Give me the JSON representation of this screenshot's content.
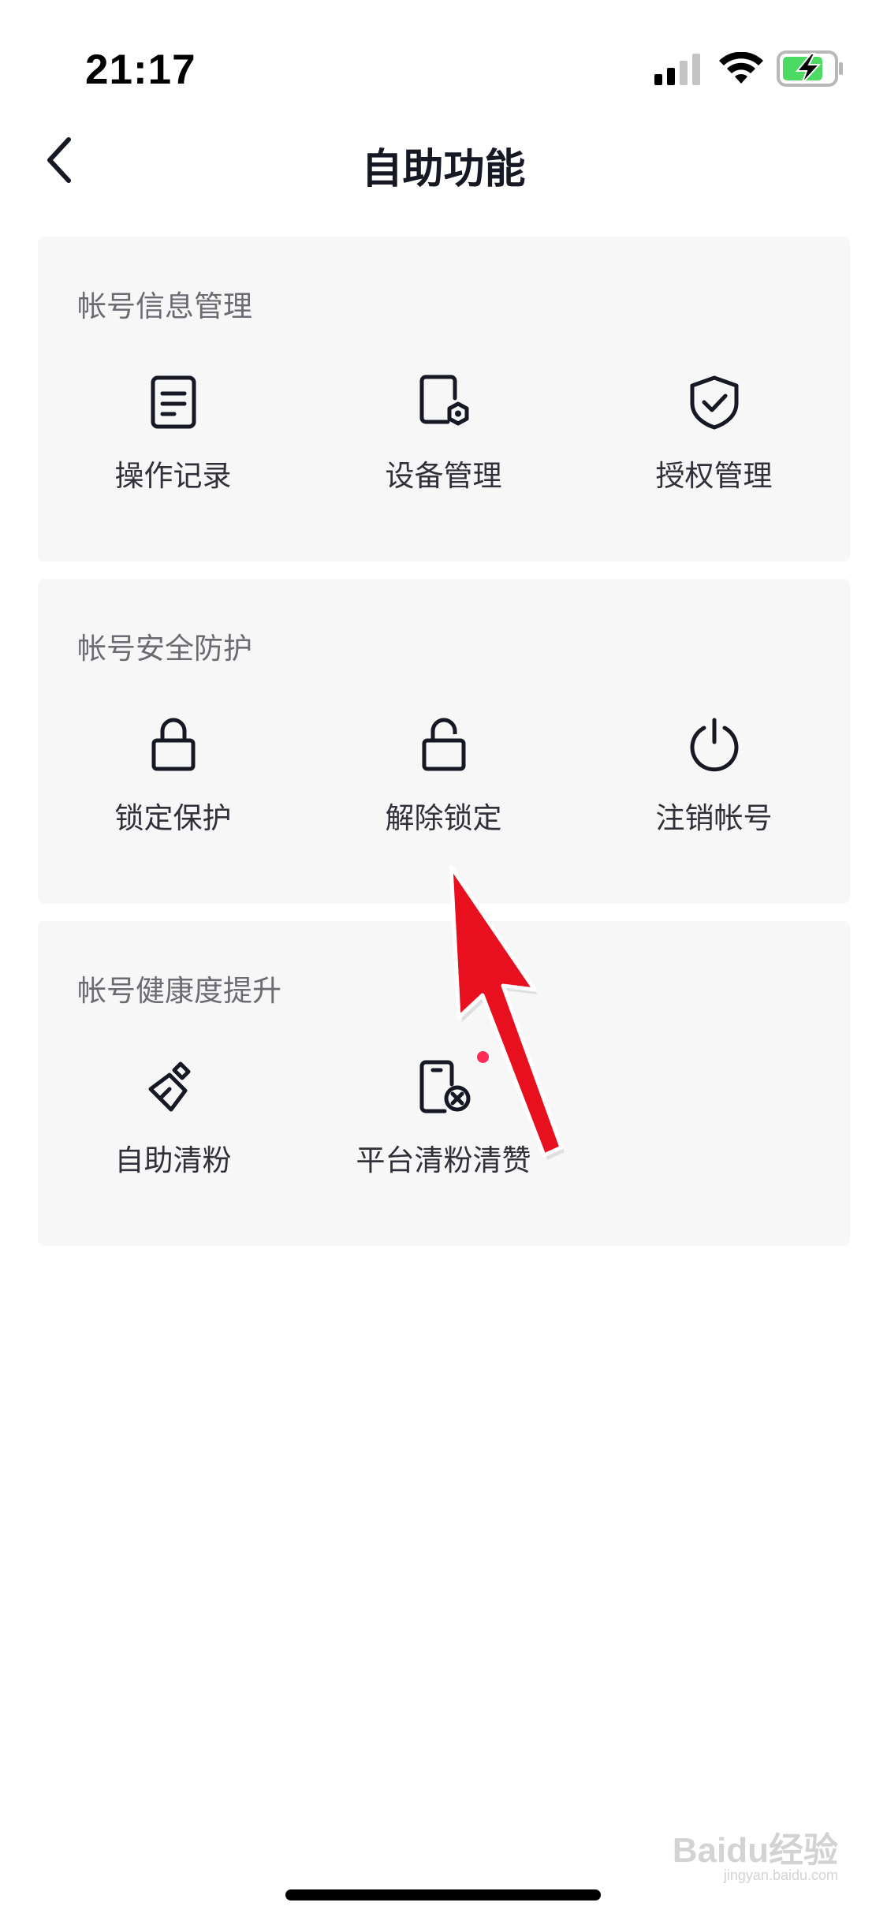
{
  "status_bar": {
    "time": "21:17",
    "icons": [
      "cellular-signal-icon",
      "wifi-icon",
      "battery-charging-icon"
    ]
  },
  "nav": {
    "title": "自助功能",
    "back_icon": "chevron-left-icon"
  },
  "sections": [
    {
      "title": "帐号信息管理",
      "items": [
        {
          "label": "操作记录",
          "icon": "document-icon"
        },
        {
          "label": "设备管理",
          "icon": "device-settings-icon"
        },
        {
          "label": "授权管理",
          "icon": "shield-check-icon"
        }
      ]
    },
    {
      "title": "帐号安全防护",
      "items": [
        {
          "label": "锁定保护",
          "icon": "lock-icon"
        },
        {
          "label": "解除锁定",
          "icon": "unlock-icon"
        },
        {
          "label": "注销帐号",
          "icon": "power-icon"
        }
      ]
    },
    {
      "title": "帐号健康度提升",
      "items": [
        {
          "label": "自助清粉",
          "icon": "broom-icon"
        },
        {
          "label": "平台清粉清赞",
          "icon": "phone-remove-icon",
          "badge": "red-dot"
        }
      ]
    }
  ],
  "watermark": {
    "text": "Baidu经验",
    "sub": "jingyan.baidu.com"
  },
  "colors": {
    "card_bg": "#f7f7f8",
    "section_title": "#6b6c72",
    "item_label": "#2f3038",
    "badge": "#fe2c55",
    "annotation_arrow": "#e8101f"
  }
}
